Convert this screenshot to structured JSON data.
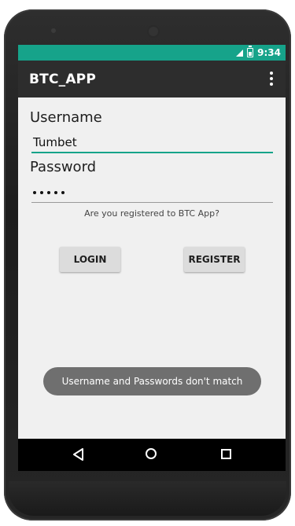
{
  "status_bar": {
    "time": "9:34",
    "icons": [
      "signal-icon",
      "battery-icon"
    ],
    "color": "#16a38a"
  },
  "app_bar": {
    "title": "BTC_APP",
    "menu_icon": "overflow-menu-icon",
    "color": "#2d2d2d"
  },
  "form": {
    "username_label": "Username",
    "username_value": "Tumbet",
    "password_label": "Password",
    "password_masked_length": 5,
    "register_prompt": "Are you registered to BTC App?",
    "accent_color": "#16a38a"
  },
  "buttons": {
    "login_label": "LOGIN",
    "register_label": "REGISTER"
  },
  "toast": {
    "message": "Username and Passwords don't match"
  },
  "nav_bar": {
    "icons": [
      "back-icon",
      "home-icon",
      "recents-icon"
    ]
  }
}
